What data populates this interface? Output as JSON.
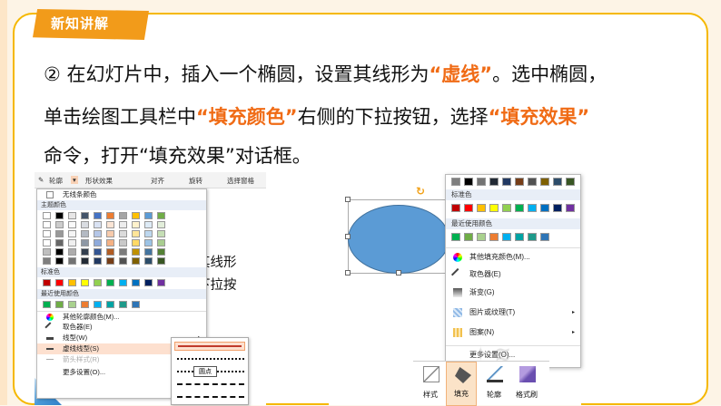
{
  "badge": "新知讲解",
  "paragraph": {
    "line1_a": "② 在幻灯片中，插入一个椭圆，设置其线形为",
    "line1_hl": "“虚线”",
    "line1_b": "。选中椭圆，",
    "line2_a": "单击绘图工具栏中",
    "line2_hl1": "“填充颜色”",
    "line2_b": "右侧的下拉按钮，选择",
    "line2_hl2": "“填充效果”",
    "line3": "命令，打开“填充效果”对话框。"
  },
  "left_shot": {
    "toolbar": {
      "outline": "轮廓",
      "shape_effect": "形状效果",
      "align": "对齐",
      "rotate": "旋转",
      "select_pane": "选择窗格"
    },
    "menu": {
      "no_line": "无线条颜色",
      "theme_colors": "主题颜色",
      "standard_colors": "标准色",
      "recent_colors": "最近使用颜色",
      "more_outline_colors": "其他轮廓颜色(M)...",
      "eyedropper": "取色器(E)",
      "line_type": "线型(W)",
      "dash_type": "虚线线型(S)",
      "arrow_style": "箭头样式(R)",
      "more_settings": "更多设置(O)..."
    },
    "bg_text1": "设置其线形",
    "bg_text2": "侧的下拉按",
    "tooltip": "圆点"
  },
  "right_shot": {
    "menu": {
      "standard_colors": "标准色",
      "recent_colors": "最近使用颜色",
      "more_fill_colors": "其他填充颜色(M)...",
      "eyedropper": "取色器(E)",
      "gradient": "渐变(G)",
      "picture_texture": "图片或纹理(T)",
      "pattern": "图案(N)",
      "more_settings": "更多设置(O)..."
    },
    "ribbon": {
      "style": "样式",
      "fill": "填充",
      "outline": "轮廓",
      "format_painter": "格式刷"
    }
  },
  "colors": {
    "accent": "#f06b15",
    "badge": "#f29b1a",
    "frame": "#f5b800",
    "ellipse": "#5b9bd5",
    "standard": [
      "#c00000",
      "#ff0000",
      "#ffc000",
      "#ffff00",
      "#92d050",
      "#00b050",
      "#00b0f0",
      "#0070c0",
      "#002060",
      "#7030a0"
    ],
    "recent": [
      "#00b050",
      "#70ad47",
      "#a9d18e",
      "#ed7d31",
      "#00b0f0",
      "#00a3a3",
      "#1f9a8a",
      "#2e75b6"
    ],
    "theme_top": [
      "#ffffff",
      "#000000",
      "#e7e6e6",
      "#44546a",
      "#4472c4",
      "#ed7d31",
      "#a5a5a5",
      "#ffc000",
      "#5b9bd5",
      "#70ad47"
    ]
  }
}
